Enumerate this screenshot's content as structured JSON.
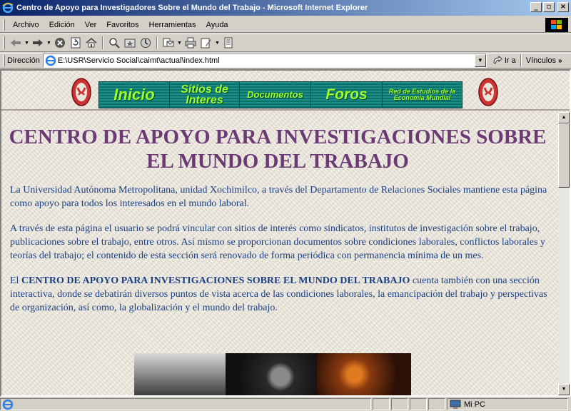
{
  "window": {
    "title": "Centro de Apoyo para Investigadores Sobre el Mundo del Trabajo - Microsoft Internet Explorer",
    "controls": {
      "minimize": "_",
      "maximize": "▫",
      "close": "×"
    }
  },
  "menubar": {
    "items": [
      "Archivo",
      "Edición",
      "Ver",
      "Favoritos",
      "Herramientas",
      "Ayuda"
    ]
  },
  "addressbar": {
    "label": "Dirección",
    "url": "E:\\USR\\Servicio Social\\caimt\\actual\\index.html",
    "go_label": "Ir a",
    "links_label": "Vínculos",
    "links_chevron": "»"
  },
  "nav": {
    "items": [
      {
        "label": "Inicio"
      },
      {
        "label": "Sitios de Interes"
      },
      {
        "label": "Documentos"
      },
      {
        "label": "Foros"
      },
      {
        "label": "Red de Estudios de la Economía Mundial"
      }
    ]
  },
  "page": {
    "heading": "CENTRO DE APOYO PARA INVESTIGACIONES SOBRE EL MUNDO DEL TRABAJO",
    "para1": "La Universidad Autónoma Metropolitana, unidad Xochimilco, a través del Departamento de Relaciones Sociales mantiene esta página como apoyo para todos los interesados en el mundo laboral.",
    "para2": "A través de esta página el usuario se podrá vincular con sitios de interés como sindicatos, institutos de investigación sobre el trabajo, publicaciones sobre el trabajo, entre otros. Así mismo se proporcionan documentos sobre condiciones laborales, conflictos laborales y teorías del trabajo; el contenido de esta sección será renovado de forma periódica con permanencia mínima de un mes.",
    "para3_prefix": "El ",
    "para3_strong": "CENTRO DE APOYO PARA INVESTIGACIONES SOBRE EL MUNDO DEL TRABAJO",
    "para3_rest": " cuenta también con una sección interactiva, donde se debatirán diversos puntos de vista acerca de las condiciones laborales, la emancipación del trabajo y perspectivas de organización, así como, la globalización y el mundo del trabajo."
  },
  "statusbar": {
    "zone": "Mi PC"
  },
  "colors": {
    "titlebar_start": "#0a246a",
    "titlebar_end": "#a6caf0",
    "heading": "#6b3a75",
    "body_text": "#1b3f83",
    "nav_text": "#9fff2a",
    "nav_bg": "#1a8f86"
  }
}
